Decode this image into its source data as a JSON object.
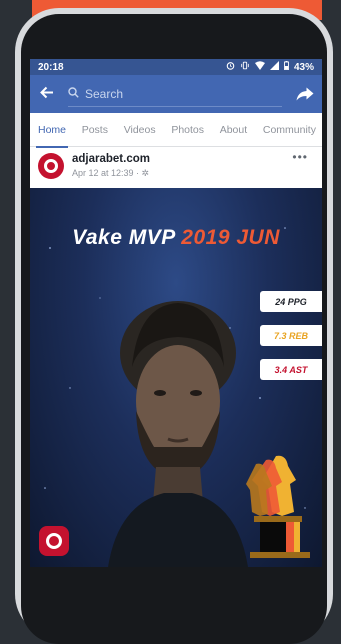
{
  "status_bar": {
    "time": "20:18",
    "battery": "43%"
  },
  "app_bar": {
    "search_placeholder": "Search"
  },
  "tabs": [
    "Home",
    "Posts",
    "Videos",
    "Photos",
    "About",
    "Community"
  ],
  "post": {
    "page_name": "adjarabet.com",
    "meta": "Apr 12 at 12:39 · ",
    "more": "•••"
  },
  "banner": {
    "headline_white": "Vake MVP ",
    "headline_orange": "2019 JUN",
    "stats": [
      {
        "label": "24 PPG",
        "color": "#1d2129"
      },
      {
        "label": "7.3 REB",
        "color": "#e8a321"
      },
      {
        "label": "3.4 AST",
        "color": "#c4122f"
      }
    ]
  },
  "colors": {
    "facebook_blue": "#4267b2",
    "status_bar": "#365592",
    "brand_red": "#c4122f",
    "accent_orange": "#ee5a35"
  },
  "icons": {
    "back": "arrow-left-icon",
    "search": "search-icon",
    "share": "share-icon",
    "privacy": "gear-icon"
  }
}
